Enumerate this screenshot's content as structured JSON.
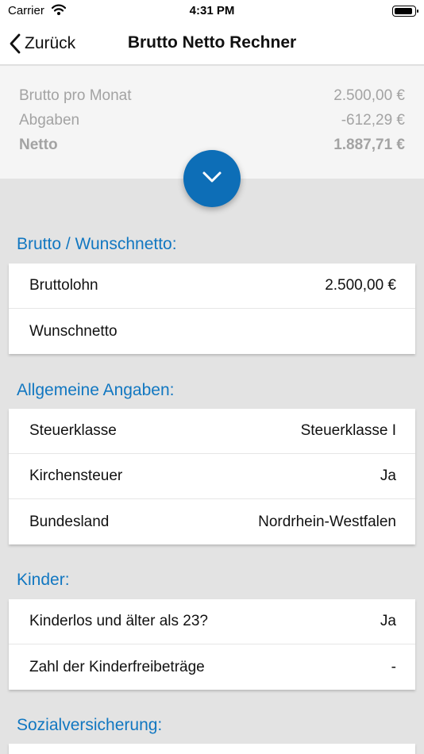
{
  "statusbar": {
    "carrier": "Carrier",
    "time": "4:31 PM"
  },
  "navbar": {
    "back_label": "Zurück",
    "title": "Brutto Netto Rechner"
  },
  "summary": {
    "brutto_label": "Brutto pro Monat",
    "brutto_value": "2.500,00 €",
    "abgaben_label": "Abgaben",
    "abgaben_value": "-612,29 €",
    "netto_label": "Netto",
    "netto_value": "1.887,71 €"
  },
  "sections": {
    "brutto": {
      "title": "Brutto / Wunschnetto:",
      "rows": [
        {
          "label": "Bruttolohn",
          "value": "2.500,00 €"
        },
        {
          "label": "Wunschnetto",
          "value": ""
        }
      ]
    },
    "allgemein": {
      "title": "Allgemeine Angaben:",
      "rows": [
        {
          "label": "Steuerklasse",
          "value": "Steuerklasse I"
        },
        {
          "label": "Kirchensteuer",
          "value": "Ja"
        },
        {
          "label": "Bundesland",
          "value": "Nordrhein-Westfalen"
        }
      ]
    },
    "kinder": {
      "title": "Kinder:",
      "rows": [
        {
          "label": "Kinderlos und älter als 23?",
          "value": "Ja"
        },
        {
          "label": "Zahl der Kinderfreibeträge",
          "value": "-"
        }
      ]
    },
    "sozial": {
      "title": "Sozialversicherung:"
    }
  },
  "colors": {
    "accent": "#0d6eb7",
    "section_title": "#1177c1",
    "summary_text": "#a3a3a3"
  },
  "icons": {
    "back": "chevron-left-icon",
    "fab": "chevron-down-icon",
    "wifi": "wifi-icon",
    "battery": "battery-icon"
  }
}
